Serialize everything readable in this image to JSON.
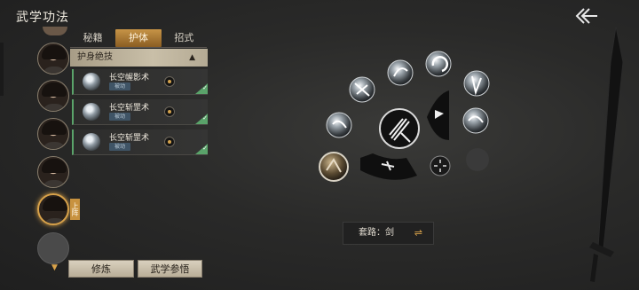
{
  "header": {
    "title": "武学功法",
    "back_icon": "back-arrow-icon"
  },
  "characters": [
    {
      "name": "character-1",
      "active": false
    },
    {
      "name": "character-2",
      "active": false
    },
    {
      "name": "character-3",
      "active": false
    },
    {
      "name": "character-4",
      "active": false
    },
    {
      "name": "character-5",
      "active": true,
      "badge": "上阵"
    },
    {
      "name": "character-6-empty",
      "active": false
    }
  ],
  "tabs": [
    {
      "label": "秘籍",
      "active": false
    },
    {
      "label": "护体",
      "active": true
    },
    {
      "label": "招式",
      "active": false
    }
  ],
  "section": {
    "title": "护身绝技",
    "collapse_icon": "chevron-up-icon"
  },
  "skills": [
    {
      "name": "长空幄影术",
      "tag": "被动",
      "equipped": true
    },
    {
      "name": "长空斩罡术",
      "tag": "被动",
      "equipped": true
    },
    {
      "name": "长空斩罡术",
      "tag": "被动",
      "equipped": true
    }
  ],
  "buttons": {
    "practice": "修炼",
    "comprehend": "武学参悟"
  },
  "formation": {
    "label": "套路：剑",
    "swap_icon": "swap-icon"
  },
  "colors": {
    "accent": "#d8a24a",
    "equipped": "#5aa36a",
    "tab_active": "#c79447"
  }
}
